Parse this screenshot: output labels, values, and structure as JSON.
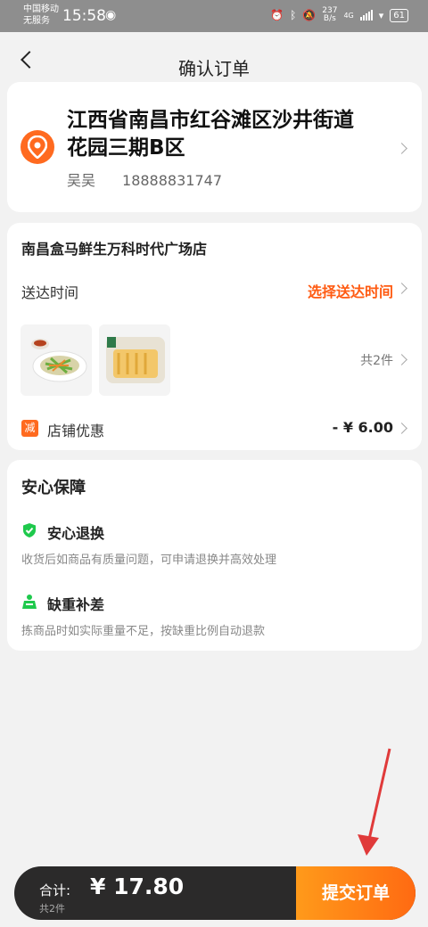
{
  "status_bar": {
    "carrier_line1": "中国移动",
    "carrier_line2": "无服务",
    "time": "15:58",
    "net_speed_value": "237",
    "net_speed_unit": "B/s",
    "battery": "61",
    "network": "4G"
  },
  "header": {
    "title": "确认订单"
  },
  "address": {
    "text": "江西省南昌市红谷滩区沙井街道花园三期B区",
    "name": "吴吴",
    "phone": "18888831747"
  },
  "store": {
    "name": "南昌盒马鲜生万科时代广场店",
    "delivery_label": "送达时间",
    "delivery_action": "选择送达时间",
    "item_count": "共2件",
    "discount_badge": "减",
    "discount_label": "店铺优惠",
    "discount_value": "- ¥ 6.00"
  },
  "guarantee": {
    "title": "安心保障",
    "items": [
      {
        "title": "安心退换",
        "desc": "收货后如商品有质量问题，可申请退换并高效处理"
      },
      {
        "title": "缺重补差",
        "desc": "拣商品时如实际重量不足，按缺重比例自动退款"
      }
    ]
  },
  "footer": {
    "total_label": "合计:",
    "total_value": "¥ 17.80",
    "total_count": "共2件",
    "submit_label": "提交订单"
  },
  "colors": {
    "accent": "#ff5b12",
    "green": "#1ec94c",
    "bar": "#2b2a2a"
  }
}
